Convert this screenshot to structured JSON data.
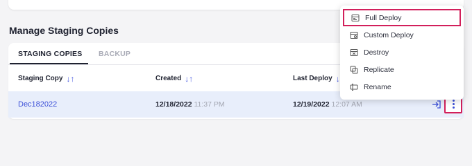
{
  "section": {
    "title": "Manage Staging Copies"
  },
  "tabs": [
    {
      "label": "STAGING COPIES",
      "active": true
    },
    {
      "label": "BACKUP",
      "active": false
    }
  ],
  "table": {
    "columns": [
      "Staging Copy",
      "Created",
      "Last Deploy"
    ],
    "rows": [
      {
        "name": "Dec182022",
        "created_date": "12/18/2022",
        "created_time": "11:37 PM",
        "deploy_date": "12/19/2022",
        "deploy_time": "12:07 AM"
      }
    ]
  },
  "menu": {
    "items": [
      {
        "label": "Full Deploy",
        "icon": "full-deploy-icon",
        "highlighted": true
      },
      {
        "label": "Custom Deploy",
        "icon": "custom-deploy-icon"
      },
      {
        "label": "Destroy",
        "icon": "destroy-icon"
      },
      {
        "label": "Replicate",
        "icon": "replicate-icon"
      },
      {
        "label": "Rename",
        "icon": "rename-icon"
      }
    ]
  },
  "colors": {
    "accent": "#3b4fd8",
    "highlight_border": "#d21f5b",
    "row_bg": "#e8eefb"
  }
}
